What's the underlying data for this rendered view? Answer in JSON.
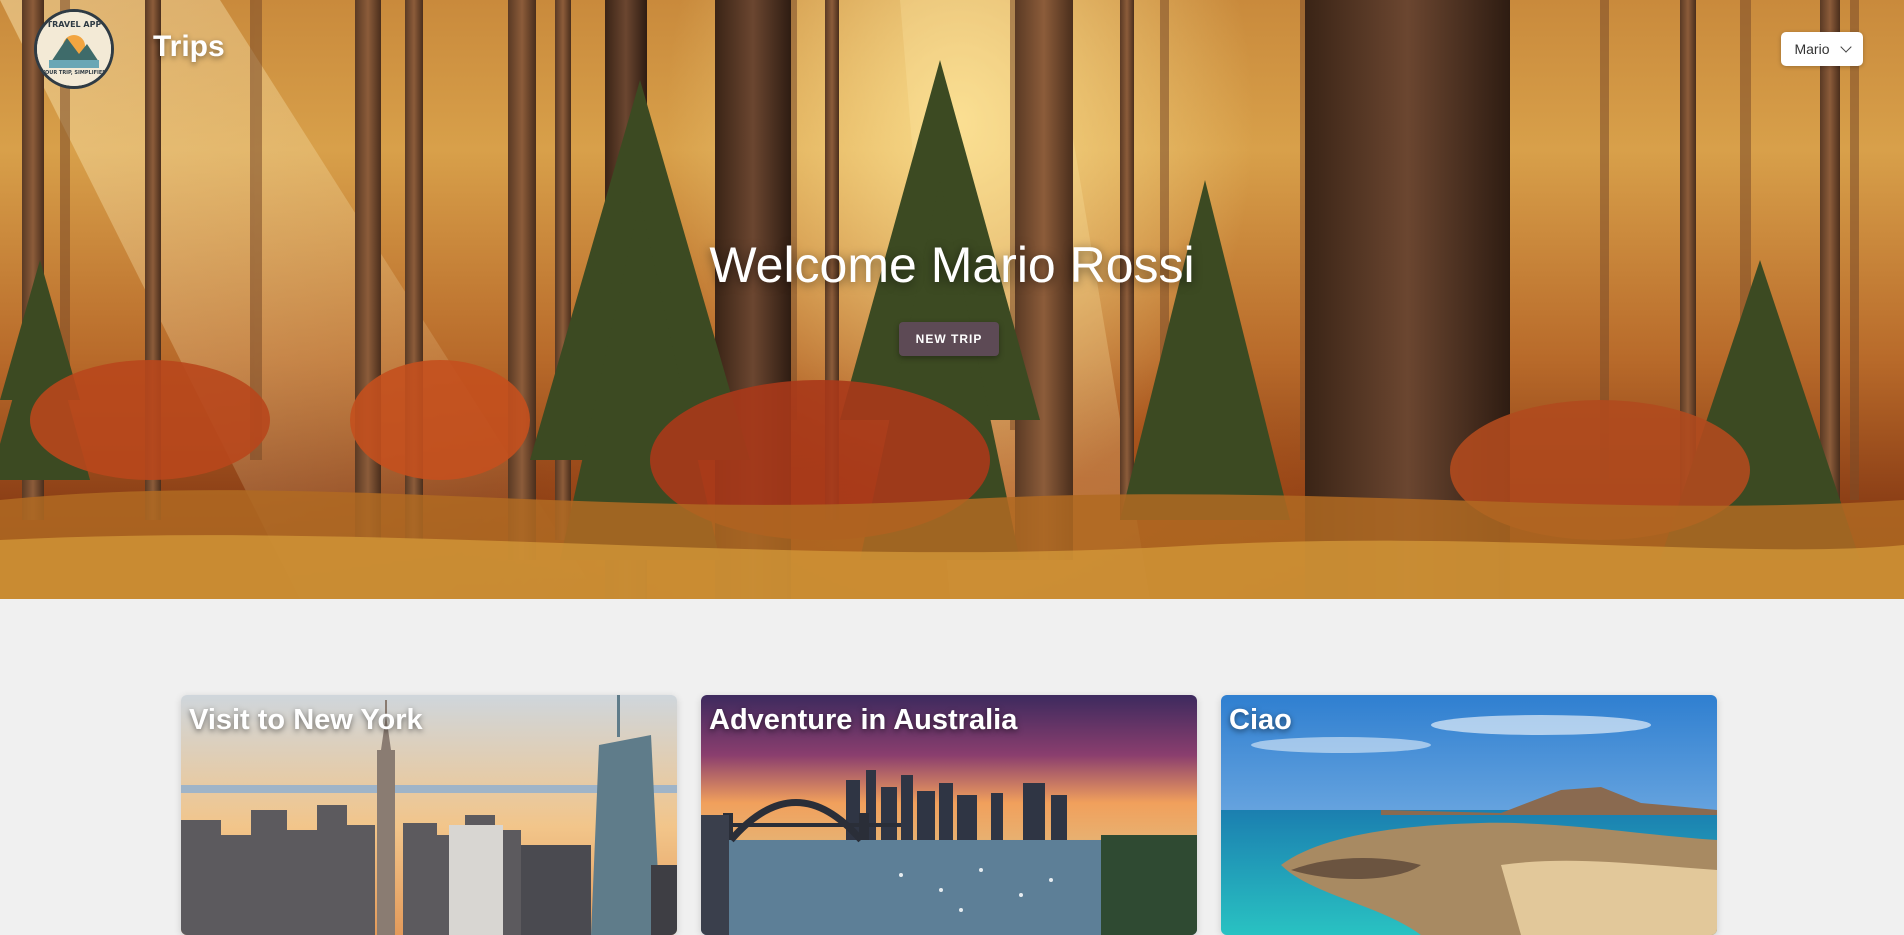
{
  "header": {
    "logo": {
      "top_text": "TRAVEL APP",
      "bottom_text": "YOUR TRIP, SIMPLIFIED",
      "icon": "mountain-lake-logo"
    },
    "title": "Trips",
    "user_menu": {
      "label": "Mario",
      "icon": "chevron-down-icon"
    }
  },
  "hero": {
    "welcome": "Welcome Mario Rossi",
    "new_trip_label": "NEW TRIP",
    "accent_color": "#5d4a55"
  },
  "trips": [
    {
      "title": "Visit to New York"
    },
    {
      "title": "Adventure in Australia"
    },
    {
      "title": "Ciao"
    }
  ]
}
